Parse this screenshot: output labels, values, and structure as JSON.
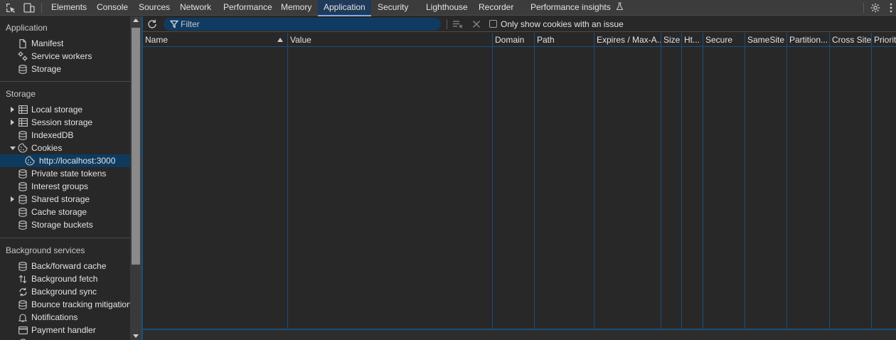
{
  "topbar": {
    "tabs": [
      {
        "label": "Elements"
      },
      {
        "label": "Console"
      },
      {
        "label": "Sources"
      },
      {
        "label": "Network"
      },
      {
        "label": "Performance"
      },
      {
        "label": "Memory"
      },
      {
        "label": "Application"
      },
      {
        "label": "Security"
      },
      {
        "label": "Lighthouse"
      },
      {
        "label": "Recorder"
      },
      {
        "label": "Performance insights"
      }
    ],
    "active_tab": "Application",
    "accent_color": "#7cacf8"
  },
  "sidebar": {
    "application": {
      "title": "Application",
      "items": [
        {
          "label": "Manifest",
          "icon": "document-icon"
        },
        {
          "label": "Service workers",
          "icon": "gears-icon"
        },
        {
          "label": "Storage",
          "icon": "database-icon"
        }
      ]
    },
    "storage": {
      "title": "Storage",
      "items": [
        {
          "label": "Local storage",
          "icon": "table-icon",
          "expandable": true
        },
        {
          "label": "Session storage",
          "icon": "table-icon",
          "expandable": true
        },
        {
          "label": "IndexedDB",
          "icon": "database-icon"
        },
        {
          "label": "Cookies",
          "icon": "cookie-icon",
          "expanded": true
        },
        {
          "label": "http://localhost:3000",
          "icon": "cookie-icon",
          "selected": true
        },
        {
          "label": "Private state tokens",
          "icon": "database-icon"
        },
        {
          "label": "Interest groups",
          "icon": "database-icon"
        },
        {
          "label": "Shared storage",
          "icon": "database-icon",
          "expandable": true
        },
        {
          "label": "Cache storage",
          "icon": "database-icon"
        },
        {
          "label": "Storage buckets",
          "icon": "database-icon"
        }
      ]
    },
    "background": {
      "title": "Background services",
      "items": [
        {
          "label": "Back/forward cache",
          "icon": "database-icon"
        },
        {
          "label": "Background fetch",
          "icon": "arrows-updown-icon"
        },
        {
          "label": "Background sync",
          "icon": "sync-icon"
        },
        {
          "label": "Bounce tracking mitigations",
          "icon": "database-icon"
        },
        {
          "label": "Notifications",
          "icon": "bell-icon"
        },
        {
          "label": "Payment handler",
          "icon": "card-icon"
        }
      ]
    }
  },
  "toolbar": {
    "filter_placeholder": "Filter",
    "issue_checkbox_label": "Only show cookies with an issue",
    "issue_checkbox_checked": false
  },
  "table": {
    "columns": [
      {
        "label": "Name",
        "sorted": "ascending"
      },
      {
        "label": "Value"
      },
      {
        "label": "Domain"
      },
      {
        "label": "Path"
      },
      {
        "label": "Expires / Max-A..."
      },
      {
        "label": "Size"
      },
      {
        "label": "Ht..."
      },
      {
        "label": "Secure"
      },
      {
        "label": "SameSite"
      },
      {
        "label": "Partition..."
      },
      {
        "label": "Cross Site"
      },
      {
        "label": "Priority"
      }
    ],
    "rows": []
  }
}
